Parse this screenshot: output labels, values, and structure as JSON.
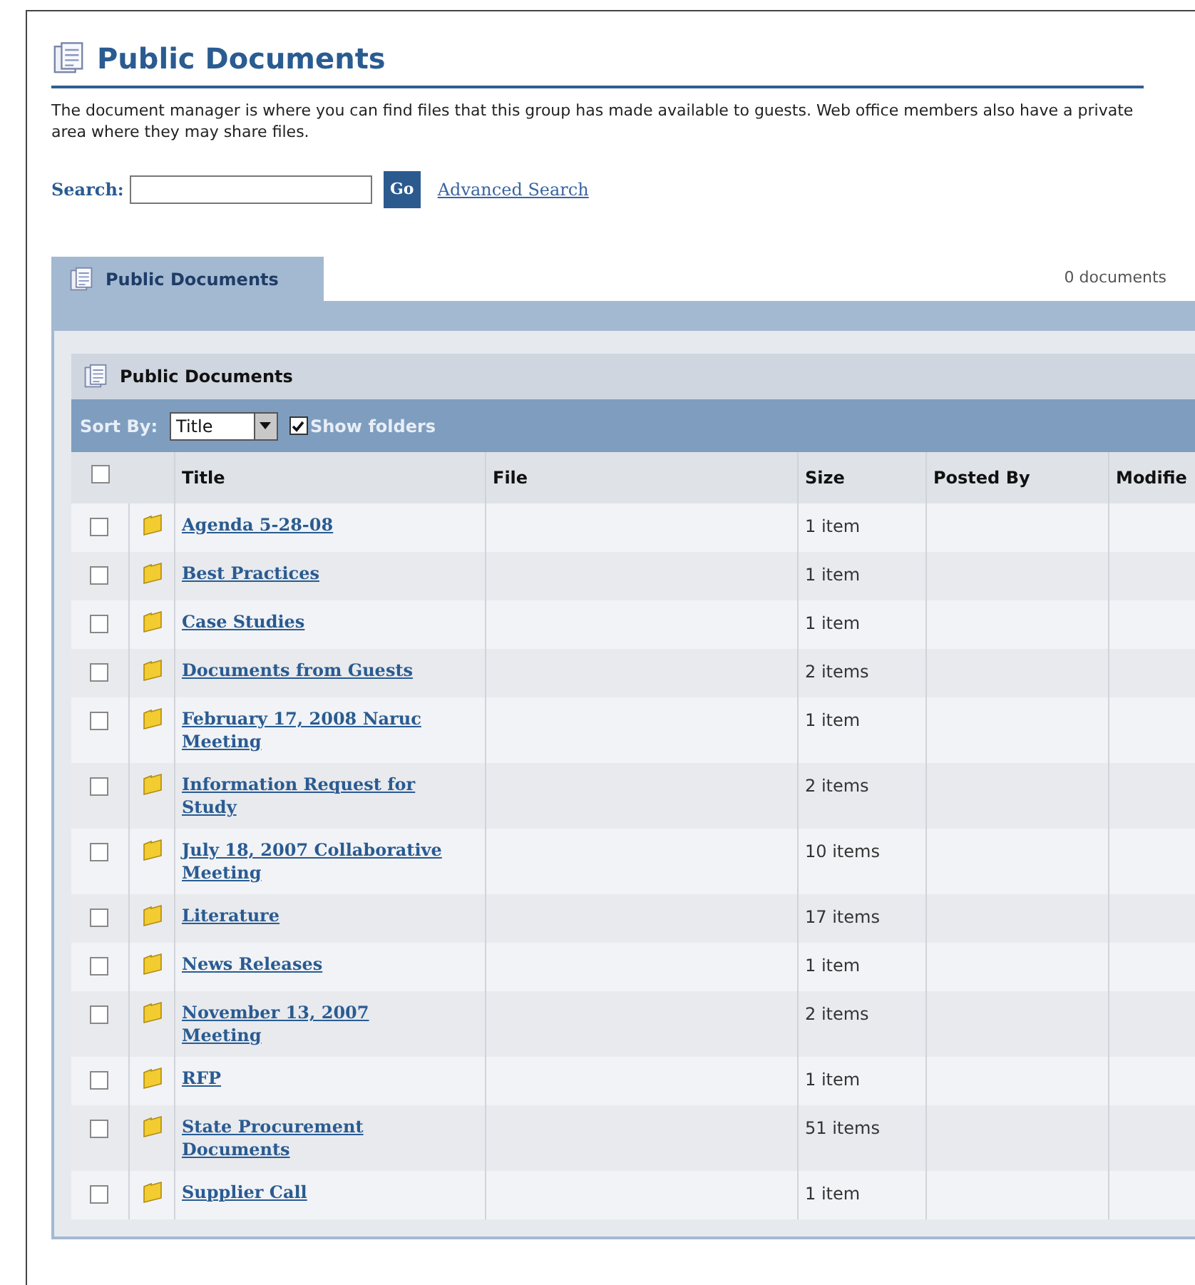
{
  "page": {
    "title": "Public Documents",
    "description": "The document manager is where you can find files that this group has made available to guests. Web office members also have a private area where they may share files."
  },
  "search": {
    "label": "Search:",
    "button": "Go",
    "advanced_link": "Advanced Search"
  },
  "tabs": [
    {
      "label": "Public Documents",
      "selected": true
    }
  ],
  "document_count": "0 documents",
  "panel": {
    "title": "Public Documents"
  },
  "toolbar": {
    "sort_label": "Sort By:",
    "sort_value": "Title",
    "show_folders": {
      "label": "Show folders",
      "checked": true
    }
  },
  "table": {
    "select_all_checked": false,
    "columns": [
      "Title",
      "File",
      "Size",
      "Posted By",
      "Modifie"
    ],
    "rows": [
      {
        "title": "Agenda 5-28-08",
        "size": "1 item",
        "checked": false
      },
      {
        "title": "Best Practices",
        "size": "1 item",
        "checked": false
      },
      {
        "title": "Case Studies",
        "size": "1 item",
        "checked": false
      },
      {
        "title": "Documents from Guests",
        "size": "2 items",
        "checked": false
      },
      {
        "title": "February 17, 2008 Naruc Meeting",
        "size": "1 item",
        "checked": false
      },
      {
        "title": "Information Request for Study",
        "size": "2 items",
        "checked": false
      },
      {
        "title": "July 18, 2007 Collaborative Meeting",
        "size": "10 items",
        "checked": false
      },
      {
        "title": "Literature",
        "size": "17 items",
        "checked": false
      },
      {
        "title": "News Releases",
        "size": "1 item",
        "checked": false
      },
      {
        "title": "November 13, 2007 Meeting",
        "size": "2 items",
        "checked": false
      },
      {
        "title": "RFP",
        "size": "1 item",
        "checked": false
      },
      {
        "title": "State Procurement Documents",
        "size": "51 items",
        "checked": false
      },
      {
        "title": "Supplier Call",
        "size": "1 item",
        "checked": false
      }
    ]
  }
}
